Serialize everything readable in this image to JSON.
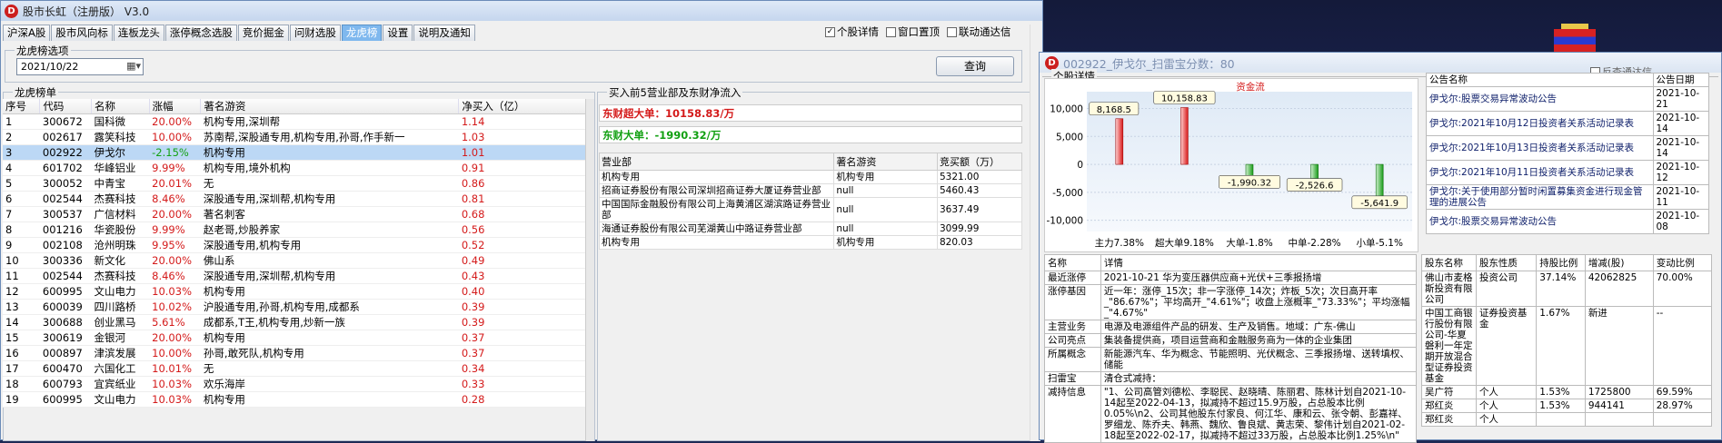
{
  "app": {
    "title": "股市长虹（注册版） V3.0"
  },
  "tabs": [
    "沪深A股",
    "股市风向标",
    "连板龙头",
    "涨停概念选股",
    "竞价掘金",
    "问财选股",
    "龙虎榜",
    "设置",
    "说明及通知"
  ],
  "options": {
    "detail": "个股详情",
    "top": "窗口置顶",
    "linked": "联动通达信"
  },
  "filter": {
    "label": "龙虎榜选项",
    "date": "2021/10/22",
    "query": "查询"
  },
  "list": {
    "label": "龙虎榜单",
    "headers": [
      "序号",
      "代码",
      "名称",
      "涨幅",
      "著名游资",
      "净买入（亿）"
    ],
    "rows": [
      [
        "1",
        "300672",
        "国科微",
        "20.00%",
        "机构专用,深圳帮",
        "1.14"
      ],
      [
        "2",
        "002617",
        "露笑科技",
        "10.00%",
        "苏南帮,深股通专用,机构专用,孙哥,作手新一",
        "1.03"
      ],
      [
        "3",
        "002922",
        "伊戈尔",
        "-2.15%",
        "机构专用",
        "1.01"
      ],
      [
        "4",
        "601702",
        "华峰铝业",
        "9.99%",
        "机构专用,境外机构",
        "0.91"
      ],
      [
        "5",
        "300052",
        "中青宝",
        "20.01%",
        "无",
        "0.86"
      ],
      [
        "6",
        "002544",
        "杰赛科技",
        "8.46%",
        "深股通专用,深圳帮,机构专用",
        "0.81"
      ],
      [
        "7",
        "300537",
        "广信材料",
        "20.00%",
        "著名刺客",
        "0.68"
      ],
      [
        "8",
        "001216",
        "华瓷股份",
        "9.99%",
        "赵老哥,炒股养家",
        "0.56"
      ],
      [
        "9",
        "002108",
        "沧州明珠",
        "9.95%",
        "深股通专用,机构专用",
        "0.52"
      ],
      [
        "10",
        "300336",
        "新文化",
        "20.00%",
        "佛山系",
        "0.49"
      ],
      [
        "11",
        "002544",
        "杰赛科技",
        "8.46%",
        "深股通专用,深圳帮,机构专用",
        "0.43"
      ],
      [
        "12",
        "600995",
        "文山电力",
        "10.03%",
        "机构专用",
        "0.40"
      ],
      [
        "13",
        "600039",
        "四川路桥",
        "10.02%",
        "沪股通专用,孙哥,机构专用,成都系",
        "0.39"
      ],
      [
        "14",
        "300688",
        "创业黑马",
        "5.61%",
        "成都系,T王,机构专用,炒新一族",
        "0.39"
      ],
      [
        "15",
        "300619",
        "金银河",
        "20.00%",
        "机构专用",
        "0.37"
      ],
      [
        "16",
        "000897",
        "津滨发展",
        "10.00%",
        "孙哥,敢死队,机构专用",
        "0.37"
      ],
      [
        "17",
        "600470",
        "六国化工",
        "10.01%",
        "无",
        "0.34"
      ],
      [
        "18",
        "600793",
        "宜宾纸业",
        "10.03%",
        "欢乐海岸",
        "0.33"
      ],
      [
        "19",
        "600995",
        "文山电力",
        "10.03%",
        "机构专用",
        "0.28"
      ]
    ]
  },
  "brokers": {
    "label": "买入前5营业部及东财净流入",
    "super": {
      "label": "东财超大单：",
      "value": "10158.83/万"
    },
    "big": {
      "label": "东财大单：",
      "value": "-1990.32/万"
    },
    "headers": [
      "营业部",
      "著名游资",
      "竞买额（万）"
    ],
    "rows": [
      [
        "机构专用",
        "机构专用",
        "5321.00"
      ],
      [
        "招商证券股份有限公司深圳招商证券大厦证券营业部",
        "null",
        "5460.43"
      ],
      [
        "中国国际金融股份有限公司上海黄浦区湖滨路证券营业部",
        "null",
        "3637.49"
      ],
      [
        "海通证券股份有限公司芜湖黄山中路证券营业部",
        "null",
        "3099.99"
      ],
      [
        "机构专用",
        "机构专用",
        "820.03"
      ]
    ]
  },
  "detail": {
    "title": "002922_伊戈尔_扫雷宝分数：80",
    "section": "个股详情",
    "opt": "反查通达信",
    "chart_data": {
      "type": "bar",
      "title": "资金流",
      "categories": [
        "主力7.38%",
        "超大单9.18%",
        "大单-1.8%",
        "中单-2.28%",
        "小单-5.1%"
      ],
      "values": [
        8168.5,
        10158.83,
        -1990.32,
        -2526.6,
        -5641.9
      ],
      "value_labels": [
        "8,168.5",
        "10,158.83",
        "-1,990.32",
        "-2,526.6",
        "-5,641.9"
      ],
      "yticks": [
        "10,000",
        "5,000",
        "0",
        "-5,000",
        "-10,000"
      ],
      "ylim": [
        -12000,
        13000
      ]
    },
    "notices": {
      "headers": [
        "公告名称",
        "公告日期"
      ],
      "rows": [
        [
          "伊戈尔:股票交易异常波动公告",
          "2021-10-21"
        ],
        [
          "伊戈尔:2021年10月12日投资者关系活动记录表",
          "2021-10-14"
        ],
        [
          "伊戈尔:2021年10月13日投资者关系活动记录表",
          "2021-10-14"
        ],
        [
          "伊戈尔:2021年10月11日投资者关系活动记录表",
          "2021-10-12"
        ],
        [
          "伊戈尔:关于使用部分暂时闲置募集资金进行现金管理的进展公告",
          "2021-10-11"
        ],
        [
          "伊戈尔:股票交易异常波动公告",
          "2021-10-08"
        ]
      ]
    },
    "info": {
      "headers": [
        "名称",
        "详情"
      ],
      "rows": [
        [
          "最近涨停",
          "2021-10-21 华为变压器供应商+光伏+三季报扬增"
        ],
        [
          "涨停基因",
          "近一年：涨停_15次；非一字涨停_14次；炸板_5次；次日高开率_\"86.67%\"；平均高开_\"4.61%\"；收盘上涨概率_\"73.33%\"；平均涨幅_\"4.67%\""
        ],
        [
          "主营业务",
          "电源及电源组件产品的研发、生产及销售。地域：广东-佛山"
        ],
        [
          "公司亮点",
          "集装备提供商，项目运营商和金融服务商为一体的企业集团"
        ],
        [
          "所属概念",
          "新能源汽车、华为概念、节能照明、光伏概念、三季报扬增、送转填权、储能"
        ],
        [
          "扫雷宝",
          "清仓式减持："
        ],
        [
          "减持信息",
          "\"1、公司高管刘德松、李聪民、赵晓晴、陈丽君、陈林计划自2021-10-14起至2022-04-13，拟减持不超过15.9万股，占总股本比例0.05%\\n2、公司其他股东付家良、何江华、康和云、张令朝、彭嘉祥、罗细龙、陈乔夫、韩燕、魏欣、鲁良斌、黄志荣、黎伟计划自2021-02-18起至2022-02-17，拟减持不超过33万股，占总股本比例1.25%\\n\""
        ]
      ]
    },
    "holders": {
      "headers": [
        "股东名称",
        "股东性质",
        "持股比例",
        "增减(股)",
        "变动比例"
      ],
      "rows": [
        [
          "佛山市麦格斯投资有限公司",
          "投资公司",
          "37.14%",
          "42062825",
          "70.00%"
        ],
        [
          "中国工商银行股份有限公司-华夏磐利一年定期开放混合型证券投资基金",
          "证券投资基金",
          "1.67%",
          "新进",
          "--"
        ],
        [
          "吴广符",
          "个人",
          "1.53%",
          "1725800",
          "69.59%"
        ],
        [
          "郑红炎",
          "个人",
          "1.53%",
          "944141",
          "28.97%"
        ],
        [
          "郑红炎",
          "个人",
          "",
          "",
          ""
        ]
      ]
    }
  }
}
